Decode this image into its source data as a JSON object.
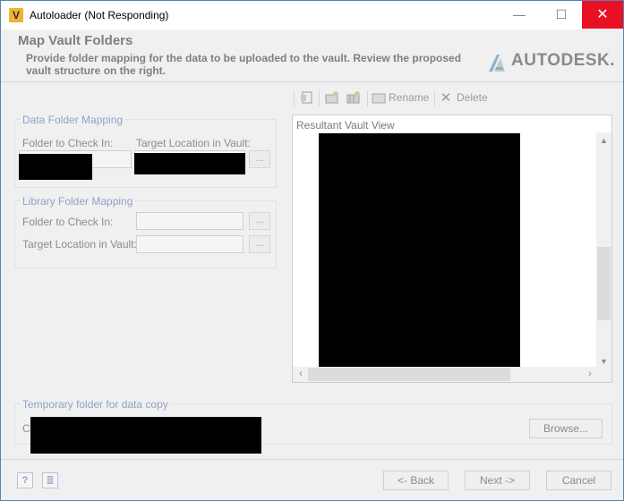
{
  "window": {
    "title": "Autoloader (Not Responding)",
    "app_icon_letter": "V",
    "minimize_glyph": "—",
    "maximize_glyph": "☐",
    "close_glyph": "✕"
  },
  "header": {
    "title": "Map Vault Folders",
    "description": "Provide folder mapping for the data to be uploaded to the vault. Review the proposed vault structure on the right.",
    "logo_text": "AUTODESK."
  },
  "data_folder_mapping": {
    "legend": "Data Folder Mapping",
    "folder_label": "Folder to Check In:",
    "target_label": "Target Location in Vault:",
    "browse_label": "..."
  },
  "library_folder_mapping": {
    "legend": "Library Folder Mapping",
    "folder_label": "Folder to Check In:",
    "target_label": "Target Location in Vault:",
    "browse_label": "..."
  },
  "toolbar": {
    "rename_label": "Rename",
    "delete_label": "Delete"
  },
  "vault_view": {
    "title": "Resultant Vault View"
  },
  "temp_folder": {
    "legend": "Temporary folder for data copy",
    "path_prefix": "C",
    "browse_label": "Browse..."
  },
  "footer": {
    "help_icon_glyph": "?",
    "log_icon_glyph": "≣",
    "back_label": "<- Back",
    "next_label": "Next ->",
    "cancel_label": "Cancel"
  },
  "colors": {
    "close_button": "#e81123",
    "legend_text": "#8fa3c8",
    "app_icon": "#f2b233"
  }
}
